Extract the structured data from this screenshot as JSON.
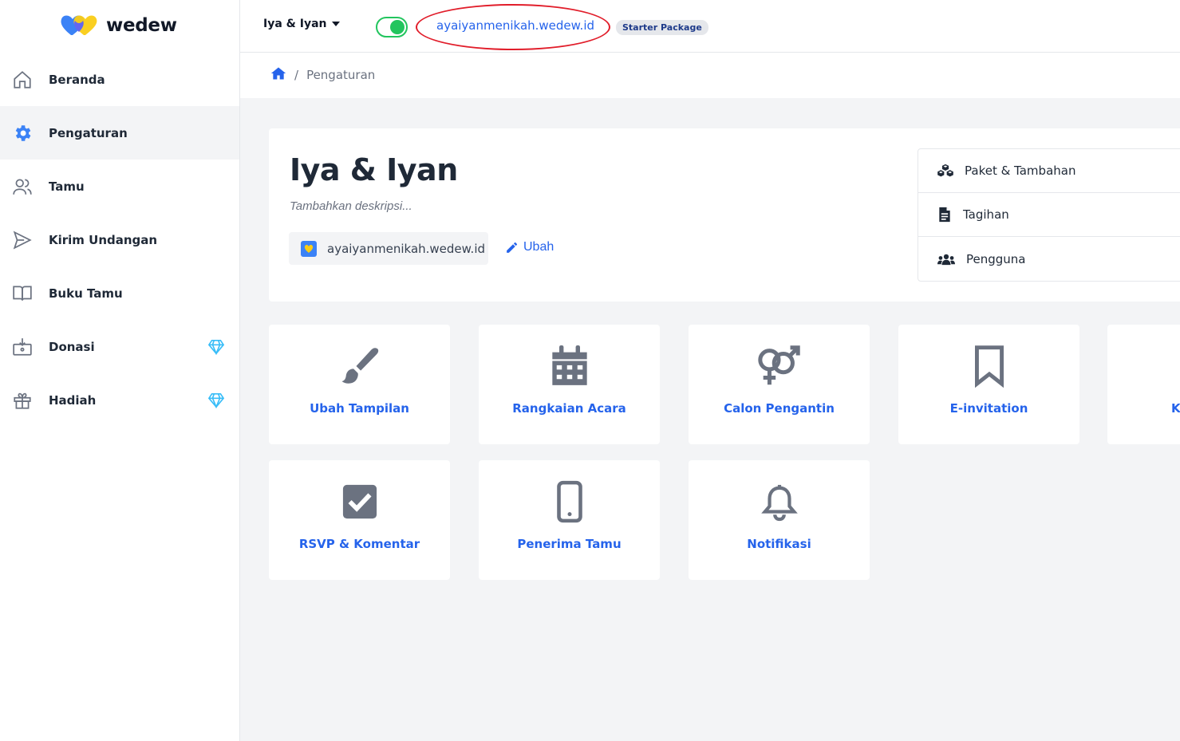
{
  "brand": {
    "name": "wedew"
  },
  "sidebar": {
    "items": [
      {
        "label": "Beranda",
        "icon": "home-icon",
        "active": false,
        "premium": false
      },
      {
        "label": "Pengaturan",
        "icon": "gear-icon",
        "active": true,
        "premium": false
      },
      {
        "label": "Tamu",
        "icon": "users-icon",
        "active": false,
        "premium": false
      },
      {
        "label": "Kirim Undangan",
        "icon": "send-icon",
        "active": false,
        "premium": false
      },
      {
        "label": "Buku Tamu",
        "icon": "book-icon",
        "active": false,
        "premium": false
      },
      {
        "label": "Donasi",
        "icon": "donation-box-icon",
        "active": false,
        "premium": true
      },
      {
        "label": "Hadiah",
        "icon": "gift-icon",
        "active": false,
        "premium": true
      }
    ]
  },
  "topbar": {
    "event_name": "Iya & Iyan",
    "published": true,
    "site_url": "ayaiyanmenikah.wedew.id",
    "package": "Starter Package"
  },
  "breadcrumb": {
    "current": "Pengaturan"
  },
  "event": {
    "title": "Iya & Iyan",
    "description_placeholder": "Tambahkan deskripsi...",
    "domain": "ayaiyanmenikah.wedew.id",
    "edit_label": "Ubah"
  },
  "side_menu": [
    {
      "label": "Paket & Tambahan",
      "icon": "cubes-icon"
    },
    {
      "label": "Tagihan",
      "icon": "invoice-icon"
    },
    {
      "label": "Pengguna",
      "icon": "users-group-icon"
    }
  ],
  "tiles": [
    {
      "label": "Ubah Tampilan",
      "icon": "paint-brush-icon"
    },
    {
      "label": "Rangkaian Acara",
      "icon": "calendar-icon"
    },
    {
      "label": "Calon Pengantin",
      "icon": "gender-icon"
    },
    {
      "label": "E-invitation",
      "icon": "bookmark-icon"
    },
    {
      "label": "K",
      "icon": ""
    },
    {
      "label": "RSVP & Komentar",
      "icon": "checkbox-icon"
    },
    {
      "label": "Penerima Tamu",
      "icon": "mobile-icon"
    },
    {
      "label": "Notifikasi",
      "icon": "bell-icon"
    }
  ],
  "colors": {
    "accent": "#2563eb",
    "toggle_on": "#22c55e",
    "highlight": "#e11d2a",
    "icon_gray": "#6b7280",
    "premium": "#38bdf8"
  }
}
